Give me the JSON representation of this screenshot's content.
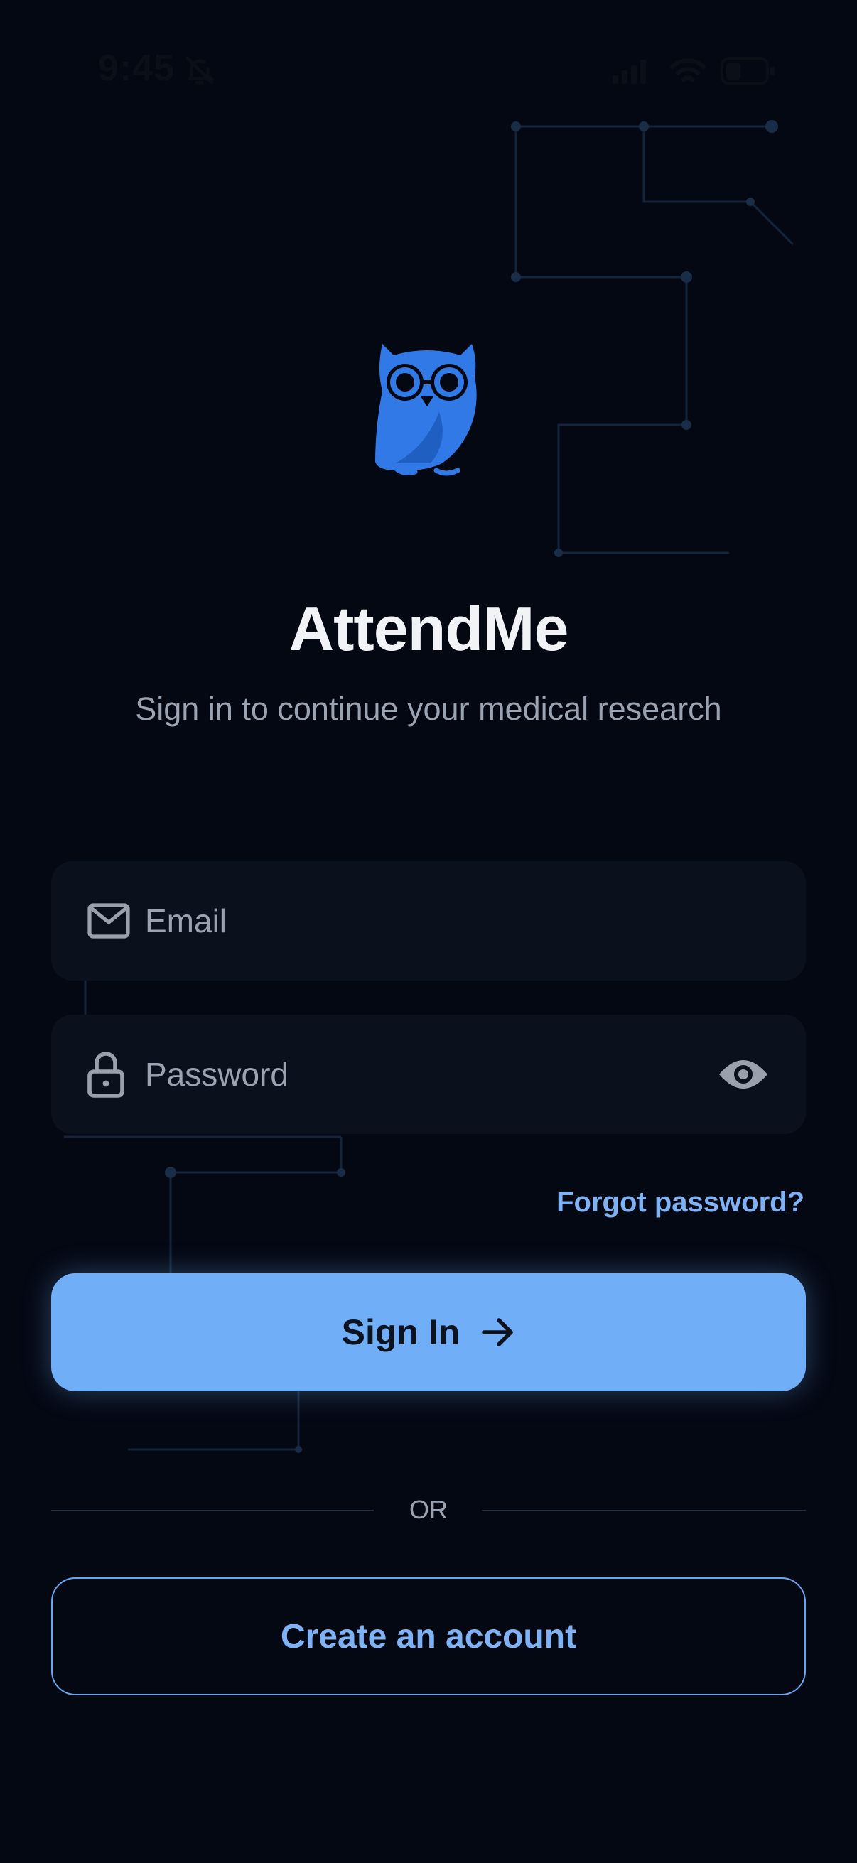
{
  "status_bar": {
    "time": "9:45",
    "icons": [
      "bell-slash-icon",
      "cellular-signal-icon",
      "wifi-icon",
      "battery-icon"
    ]
  },
  "app": {
    "logo_icon": "owl-logo-icon",
    "title": "AttendMe",
    "subtitle": "Sign in to continue your medical research"
  },
  "form": {
    "email": {
      "placeholder": "Email",
      "value": "",
      "icon": "mail-icon"
    },
    "password": {
      "placeholder": "Password",
      "value": "",
      "icon": "lock-icon",
      "toggle_icon": "eye-icon"
    },
    "forgot_label": "Forgot password?",
    "signin_label": "Sign In",
    "signin_icon": "arrow-right-icon",
    "divider_label": "OR",
    "create_label": "Create an account"
  },
  "colors": {
    "background": "#040813",
    "accent": "#70aff7",
    "link": "#7fb2f5",
    "logo": "#3079e6",
    "field_bg": "#0b111c"
  }
}
